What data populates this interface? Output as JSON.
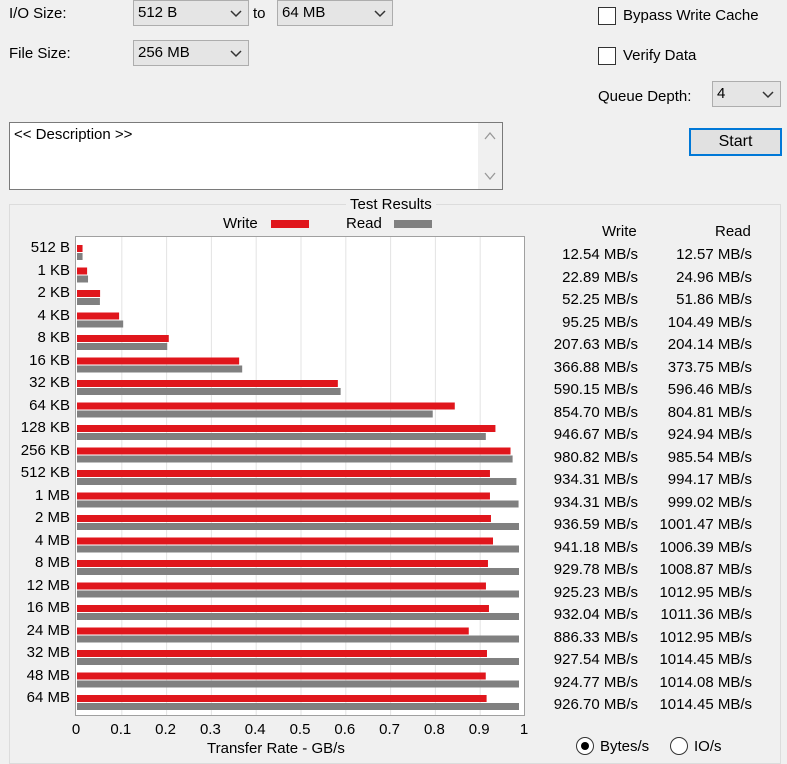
{
  "controls": {
    "io_size_label": "I/O Size:",
    "io_size_from": "512 B",
    "to_label": "to",
    "io_size_to": "64 MB",
    "file_size_label": "File Size:",
    "file_size": "256 MB",
    "bypass_write_cache_label": "Bypass Write Cache",
    "verify_data_label": "Verify Data",
    "queue_depth_label": "Queue Depth:",
    "queue_depth": "4",
    "description_value": "<< Description >>",
    "start_label": "Start"
  },
  "results": {
    "group_title": "Test Results",
    "write_header": "Write",
    "read_header": "Read",
    "write_values": [
      "12.54 MB/s",
      "22.89 MB/s",
      "52.25 MB/s",
      "95.25 MB/s",
      "207.63 MB/s",
      "366.88 MB/s",
      "590.15 MB/s",
      "854.70 MB/s",
      "946.67 MB/s",
      "980.82 MB/s",
      "934.31 MB/s",
      "934.31 MB/s",
      "936.59 MB/s",
      "941.18 MB/s",
      "929.78 MB/s",
      "925.23 MB/s",
      "932.04 MB/s",
      "886.33 MB/s",
      "927.54 MB/s",
      "924.77 MB/s",
      "926.70 MB/s"
    ],
    "read_values": [
      "12.57 MB/s",
      "24.96 MB/s",
      "51.86 MB/s",
      "104.49 MB/s",
      "204.14 MB/s",
      "373.75 MB/s",
      "596.46 MB/s",
      "804.81 MB/s",
      "924.94 MB/s",
      "985.54 MB/s",
      "994.17 MB/s",
      "999.02 MB/s",
      "1001.47 MB/s",
      "1006.39 MB/s",
      "1008.87 MB/s",
      "1012.95 MB/s",
      "1011.36 MB/s",
      "1012.95 MB/s",
      "1014.45 MB/s",
      "1014.08 MB/s",
      "1014.45 MB/s"
    ]
  },
  "units": {
    "bytes_label": "Bytes/s",
    "io_label": "IO/s",
    "selected": "bytes"
  },
  "chart_data": {
    "type": "bar",
    "orientation": "horizontal",
    "xlabel": "Transfer Rate - GB/s",
    "xlim": [
      0,
      1
    ],
    "xticks": [
      "0",
      "0.1",
      "0.2",
      "0.3",
      "0.4",
      "0.5",
      "0.6",
      "0.7",
      "0.8",
      "0.9",
      "1"
    ],
    "grid": true,
    "legend_placement": "top",
    "categories": [
      "512 B",
      "1 KB",
      "2 KB",
      "4 KB",
      "8 KB",
      "16 KB",
      "32 KB",
      "64 KB",
      "128 KB",
      "256 KB",
      "512 KB",
      "1 MB",
      "2 MB",
      "4 MB",
      "8 MB",
      "12 MB",
      "16 MB",
      "24 MB",
      "32 MB",
      "48 MB",
      "64 MB"
    ],
    "series": [
      {
        "name": "Write",
        "color": "#e0161c",
        "values": [
          0.01254,
          0.02289,
          0.05225,
          0.09525,
          0.20763,
          0.36688,
          0.59015,
          0.8547,
          0.94667,
          0.98082,
          0.93431,
          0.93431,
          0.93659,
          0.94118,
          0.92978,
          0.92523,
          0.93204,
          0.88633,
          0.92754,
          0.92477,
          0.9267
        ]
      },
      {
        "name": "Read",
        "color": "#808080",
        "values": [
          0.01257,
          0.02496,
          0.05186,
          0.10449,
          0.20414,
          0.37375,
          0.59646,
          0.80481,
          0.92494,
          0.98554,
          0.99417,
          0.99902,
          1.00147,
          1.00639,
          1.00887,
          1.01295,
          1.01136,
          1.01295,
          1.01445,
          1.01408,
          1.01445
        ]
      }
    ]
  }
}
